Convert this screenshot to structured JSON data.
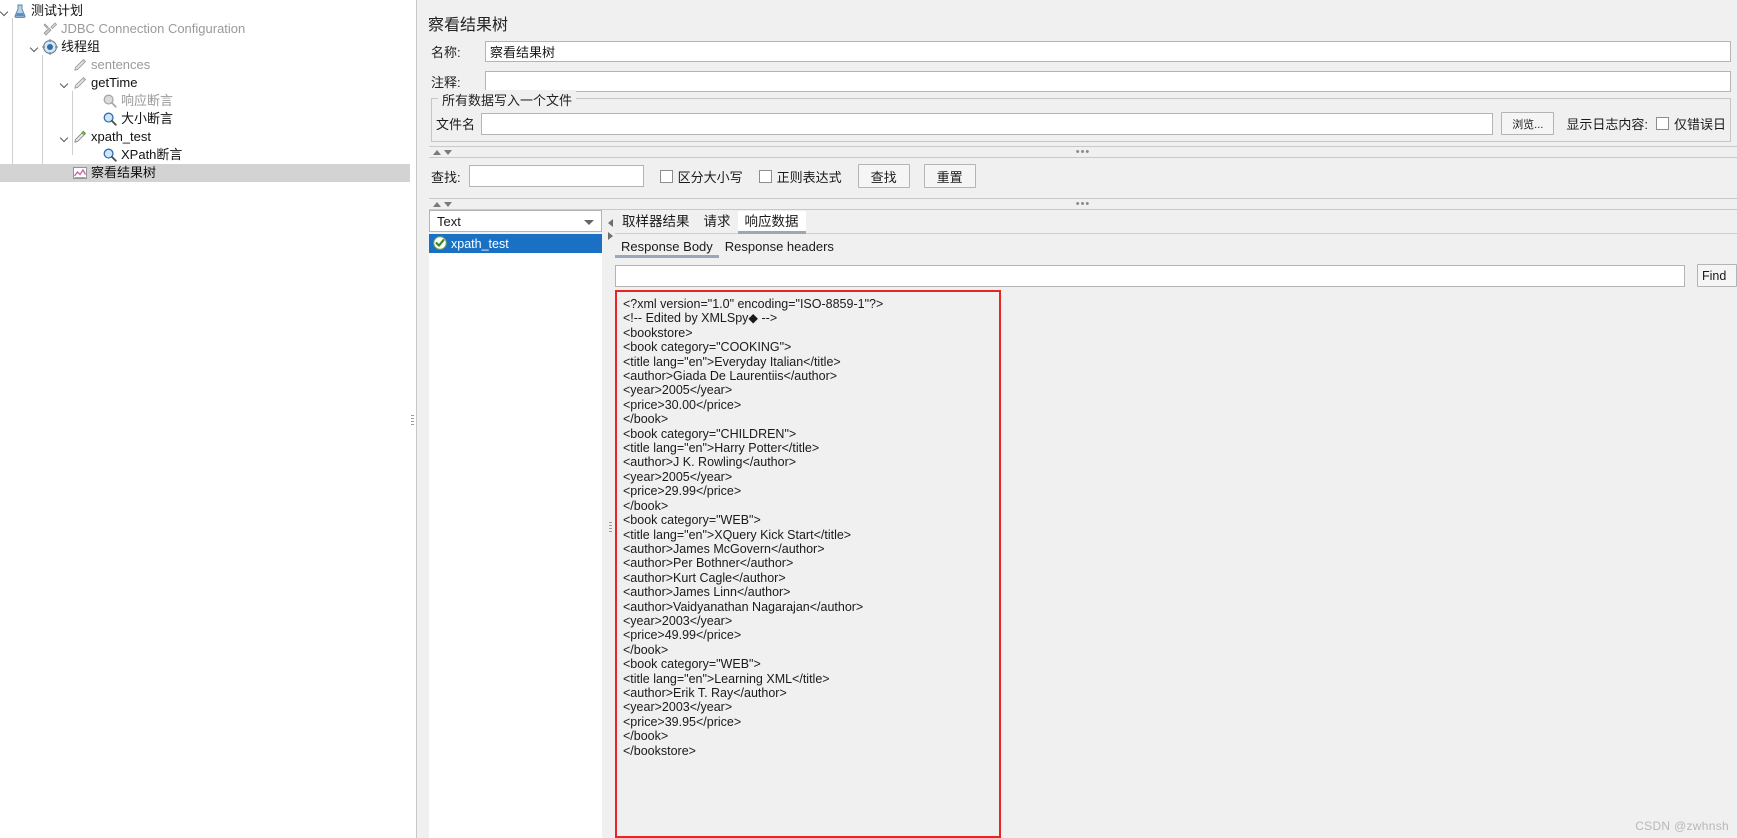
{
  "tree": {
    "nodes": [
      {
        "label": "测试计划",
        "icon": "test-plan-icon",
        "depth": 0,
        "twisty": "open",
        "style": "dark",
        "selected": false
      },
      {
        "label": "JDBC Connection Configuration",
        "icon": "jdbc-config-icon",
        "depth": 1,
        "twisty": "none",
        "style": "dim",
        "selected": false
      },
      {
        "label": "线程组",
        "icon": "thread-group-icon",
        "depth": 1,
        "twisty": "open",
        "style": "dark",
        "selected": false
      },
      {
        "label": "sentences",
        "icon": "sampler-icon",
        "depth": 2,
        "twisty": "none",
        "style": "dim",
        "selected": false
      },
      {
        "label": "getTime",
        "icon": "sampler-icon",
        "depth": 2,
        "twisty": "open",
        "style": "dark",
        "selected": false
      },
      {
        "label": "响应断言",
        "icon": "assertion-icon-disabled",
        "depth": 3,
        "twisty": "none",
        "style": "dim",
        "selected": false
      },
      {
        "label": "大小断言",
        "icon": "assertion-icon",
        "depth": 3,
        "twisty": "none",
        "style": "dark",
        "selected": false
      },
      {
        "label": "xpath_test",
        "icon": "sampler-icon-green",
        "depth": 2,
        "twisty": "open",
        "style": "dark",
        "selected": false
      },
      {
        "label": "XPath断言",
        "icon": "assertion-icon",
        "depth": 3,
        "twisty": "none",
        "style": "dark",
        "selected": false
      },
      {
        "label": "察看结果树",
        "icon": "view-results-tree-icon",
        "depth": 2,
        "twisty": "none",
        "style": "dark",
        "selected": true
      }
    ]
  },
  "panel": {
    "title": "察看结果树",
    "name_label": "名称:",
    "name_value": "察看结果树",
    "comment_label": "注释:",
    "comment_value": "",
    "comment_placeholder": "",
    "groupbox_title": "所有数据写入一个文件",
    "file_label": "文件名",
    "file_value": "",
    "browse_button": "浏览...",
    "log_label": "显示日志内容:",
    "errors_only_label": "仅错误日"
  },
  "search": {
    "label": "查找:",
    "value": "",
    "case_sensitive_label": "区分大小写",
    "regex_label": "正则表达式",
    "find_button": "查找",
    "reset_button": "重置"
  },
  "results": {
    "renderer": "Text",
    "items": [
      {
        "label": "xpath_test",
        "status": "ok",
        "selected": true
      }
    ]
  },
  "tabs": {
    "main": [
      {
        "label": "取样器结果",
        "active": false
      },
      {
        "label": "请求",
        "active": false
      },
      {
        "label": "响应数据",
        "active": true
      }
    ],
    "sub": [
      {
        "label": "Response Body",
        "active": true
      },
      {
        "label": "Response headers",
        "active": false
      }
    ]
  },
  "findbar": {
    "value": "",
    "button": "Find"
  },
  "response_body": {
    "highlight_color": "#e8251f",
    "lines": [
      "<?xml version=\"1.0\" encoding=\"ISO-8859-1\"?>",
      "<!-- Edited by XMLSpy◆ -->",
      "<bookstore>",
      "<book category=\"COOKING\">",
      "<title lang=\"en\">Everyday Italian</title>",
      "<author>Giada De Laurentiis</author>",
      "<year>2005</year>",
      "<price>30.00</price>",
      "</book>",
      "<book category=\"CHILDREN\">",
      "<title lang=\"en\">Harry Potter</title>",
      "<author>J K. Rowling</author>",
      "<year>2005</year>",
      "<price>29.99</price>",
      "</book>",
      "<book category=\"WEB\">",
      "<title lang=\"en\">XQuery Kick Start</title>",
      "<author>James McGovern</author>",
      "<author>Per Bothner</author>",
      "<author>Kurt Cagle</author>",
      "<author>James Linn</author>",
      "<author>Vaidyanathan Nagarajan</author>",
      "<year>2003</year>",
      "<price>49.99</price>",
      "</book>",
      "<book category=\"WEB\">",
      "<title lang=\"en\">Learning XML</title>",
      "<author>Erik T. Ray</author>",
      "<year>2003</year>",
      "<price>39.95</price>",
      "</book>",
      "</bookstore>"
    ]
  },
  "watermark": "CSDN @zwhnsh"
}
